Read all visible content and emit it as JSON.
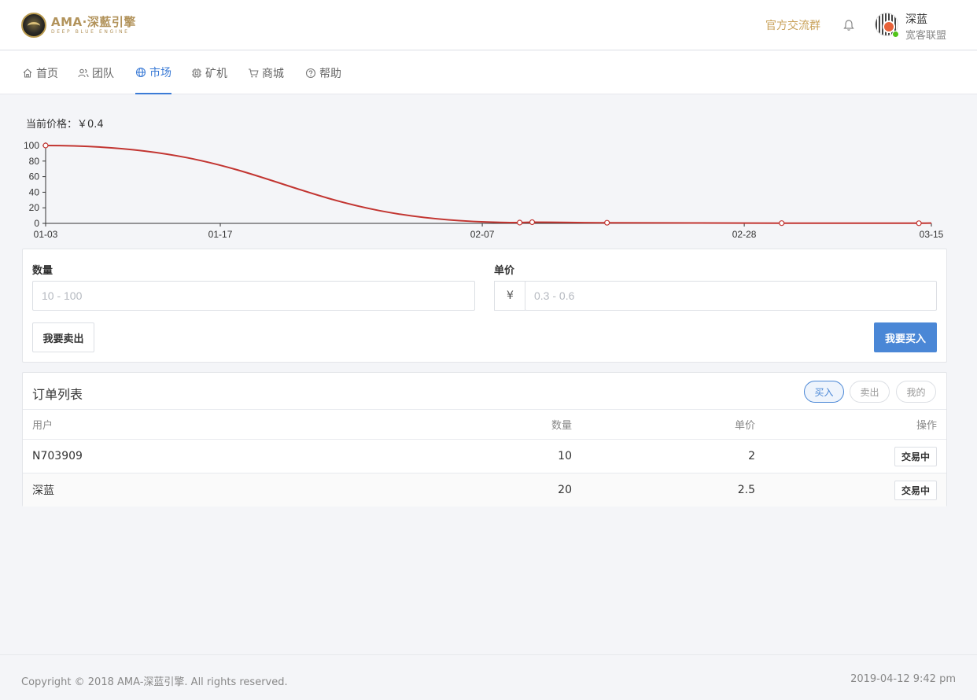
{
  "brand": {
    "title": "AMA·深藍引擎",
    "subtitle": "DEEP BLUE ENGINE"
  },
  "header": {
    "group_link": "官方交流群",
    "user_name": "深蓝",
    "user_org": "宽客联盟"
  },
  "nav": [
    {
      "label": "首页",
      "icon": "home-icon"
    },
    {
      "label": "团队",
      "icon": "users-icon"
    },
    {
      "label": "市场",
      "icon": "globe-icon",
      "active": true
    },
    {
      "label": "矿机",
      "icon": "chip-icon"
    },
    {
      "label": "商城",
      "icon": "cart-icon"
    },
    {
      "label": "帮助",
      "icon": "help-icon"
    }
  ],
  "price": {
    "label": "当前价格：￥0.4"
  },
  "chart_data": {
    "type": "line",
    "x": [
      "01-03",
      "02-10",
      "02-11",
      "02-17",
      "03-03",
      "03-14",
      "03-15"
    ],
    "y": [
      100,
      1,
      1.5,
      0.8,
      0.3,
      0.2,
      0.4
    ],
    "xticks": [
      "01-03",
      "01-17",
      "02-07",
      "02-28",
      "03-15"
    ],
    "yticks": [
      0,
      20,
      40,
      60,
      80,
      100
    ],
    "ylim": [
      0,
      100
    ],
    "xrange": [
      "01-03",
      "03-15"
    ],
    "grid": false,
    "color": "#c23531"
  },
  "form": {
    "qty_label": "数量",
    "qty_placeholder": "10 - 100",
    "price_label": "单价",
    "currency": "¥",
    "price_placeholder": "0.3 - 0.6",
    "sell_label": "我要卖出",
    "buy_label": "我要买入"
  },
  "orders": {
    "title": "订单列表",
    "filters": [
      {
        "label": "买入",
        "active": true
      },
      {
        "label": "卖出"
      },
      {
        "label": "我的"
      }
    ],
    "columns": [
      "用户",
      "数量",
      "单价",
      "操作"
    ],
    "rows": [
      {
        "user": "N703909",
        "qty": "10",
        "price": "2",
        "action": "交易中"
      },
      {
        "user": "深蓝",
        "qty": "20",
        "price": "2.5",
        "action": "交易中"
      }
    ]
  },
  "footer": {
    "copyright": "Copyright © 2018 AMA-深蓝引擎. All rights reserved.",
    "timestamp": "2019-04-12 9:42 pm"
  },
  "colors": {
    "accent": "#4a87d6",
    "gold": "#c9a25a",
    "line": "#c23531",
    "online": "#52c41a"
  }
}
